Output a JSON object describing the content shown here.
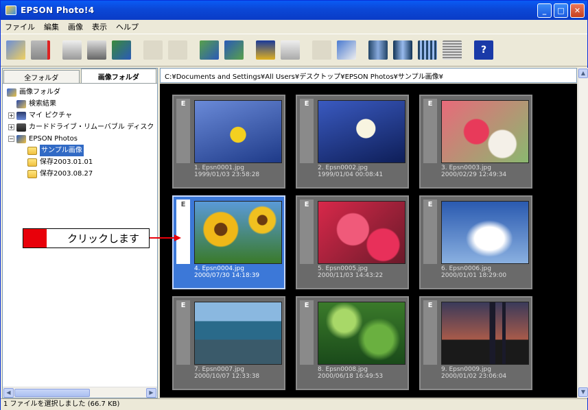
{
  "window": {
    "title": "EPSON Photo!4"
  },
  "menu": [
    "ファイル",
    "編集",
    "画像",
    "表示",
    "ヘルプ"
  ],
  "folder_tabs": [
    "全フォルダ",
    "画像フォルダ"
  ],
  "tree": {
    "root": "画像フォルダ",
    "search": "検索結果",
    "pictures": "マイ ピクチャ",
    "cardrive": "カードドライブ・リムーバブル ディスク",
    "epson": "EPSON Photos",
    "sample": "サンプル画像",
    "save1": "保存2003.01.01",
    "save2": "保存2003.08.27"
  },
  "path": "C:¥Documents and Settings¥All Users¥デスクトップ¥EPSON Photos¥サンプル画像¥",
  "thumbnails": [
    {
      "badge": "E",
      "name": "1. Epsn0001.jpg",
      "date": "1999/01/03 23:58:28",
      "color": "#2a4ea8"
    },
    {
      "badge": "E",
      "name": "2. Epsn0002.jpg",
      "date": "1999/01/04 00:08:41",
      "color": "#1e3a88"
    },
    {
      "badge": "E",
      "name": "3. Epsn0003.jpg",
      "date": "2000/02/29 12:49:34",
      "color": "#d04a5a"
    },
    {
      "badge": "E",
      "name": "4. Epsn0004.jpg",
      "date": "2000/07/30 14:18:39",
      "color": "#e8b418"
    },
    {
      "badge": "E",
      "name": "5. Epsn0005.jpg",
      "date": "2000/11/03 14:43:22",
      "color": "#d8284a"
    },
    {
      "badge": "E",
      "name": "6. Epsn0006.jpg",
      "date": "2000/01/01 18:29:00",
      "color": "#5a86c8"
    },
    {
      "badge": "E",
      "name": "7. Epsn0007.jpg",
      "date": "2000/10/07 12:33:38",
      "color": "#3d6a8a"
    },
    {
      "badge": "E",
      "name": "8. Epsn0008.jpg",
      "date": "2000/06/18 16:49:53",
      "color": "#4a8a2a"
    },
    {
      "badge": "E",
      "name": "9. Epsn0009.jpg",
      "date": "2000/01/02 23:06:04",
      "color": "#5a3a4a"
    }
  ],
  "status": "1 ファイルを選択しました (66.7 KB)",
  "callout": "クリックします",
  "colors": {
    "selection": "#316ac5",
    "callout_red": "#e8000a",
    "gallery_bg": "#000000"
  }
}
